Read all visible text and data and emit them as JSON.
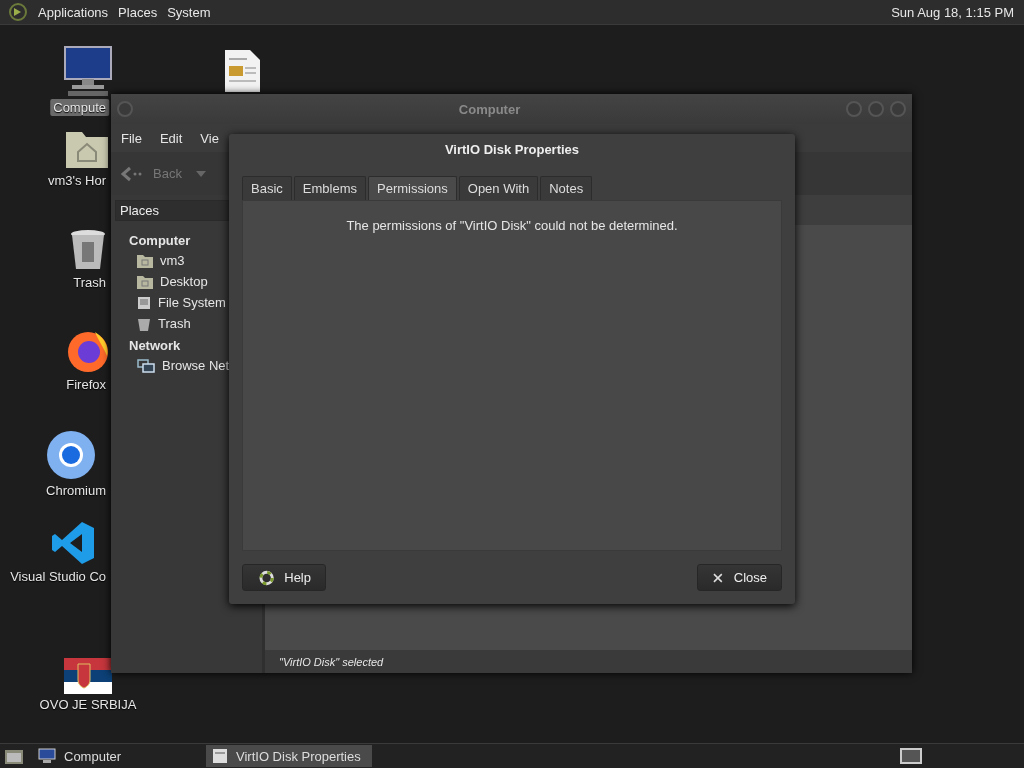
{
  "top_panel": {
    "menus": [
      "Applications",
      "Places",
      "System"
    ],
    "clock": "Sun Aug 18, 1:15 PM"
  },
  "desktop_icons": [
    {
      "kind": "computer",
      "label": "Compute",
      "selected": true
    },
    {
      "kind": "document"
    },
    {
      "kind": "home",
      "label": "vm3's Hor",
      "selected": false
    },
    {
      "kind": "trash",
      "label": "Trash",
      "selected": false
    },
    {
      "kind": "firefox",
      "label": "Firefox",
      "selected": false
    },
    {
      "kind": "chromium",
      "label": "Chromium",
      "selected": false
    },
    {
      "kind": "vscode",
      "label": "Visual Studio Co",
      "selected": false
    },
    {
      "kind": "flag",
      "label": "OVO JE SRBIJA",
      "selected": false
    }
  ],
  "file_manager": {
    "title": "Computer",
    "menus": [
      "File",
      "Edit",
      "Vie"
    ],
    "back_label": "Back",
    "places_label": "Places",
    "sidebar": [
      {
        "heading": "Computer",
        "items": [
          {
            "kind": "home",
            "label": "vm3"
          },
          {
            "kind": "desktop",
            "label": "Desktop"
          },
          {
            "kind": "drive",
            "label": "File System"
          },
          {
            "kind": "trash",
            "label": "Trash"
          }
        ]
      },
      {
        "heading": "Network",
        "items": [
          {
            "kind": "network",
            "label": "Browse Net"
          }
        ]
      }
    ],
    "status": "\"VirtIO Disk\" selected"
  },
  "dialog": {
    "title": "VirtIO Disk Properties",
    "tabs": [
      {
        "label": "Basic",
        "selected": false
      },
      {
        "label": "Emblems",
        "selected": false
      },
      {
        "label": "Permissions",
        "selected": true
      },
      {
        "label": "Open With",
        "selected": false
      },
      {
        "label": "Notes",
        "selected": false
      }
    ],
    "message": "The permissions of \"VirtIO Disk\" could not be determined.",
    "buttons": [
      {
        "kind": "help",
        "label": "Help"
      },
      {
        "kind": "close",
        "label": "Close"
      }
    ]
  },
  "taskbar": {
    "tasks": [
      {
        "kind": "computer",
        "label": "Computer",
        "selected": false
      },
      {
        "kind": "document",
        "label": "VirtIO Disk Properties",
        "selected": true
      }
    ]
  }
}
